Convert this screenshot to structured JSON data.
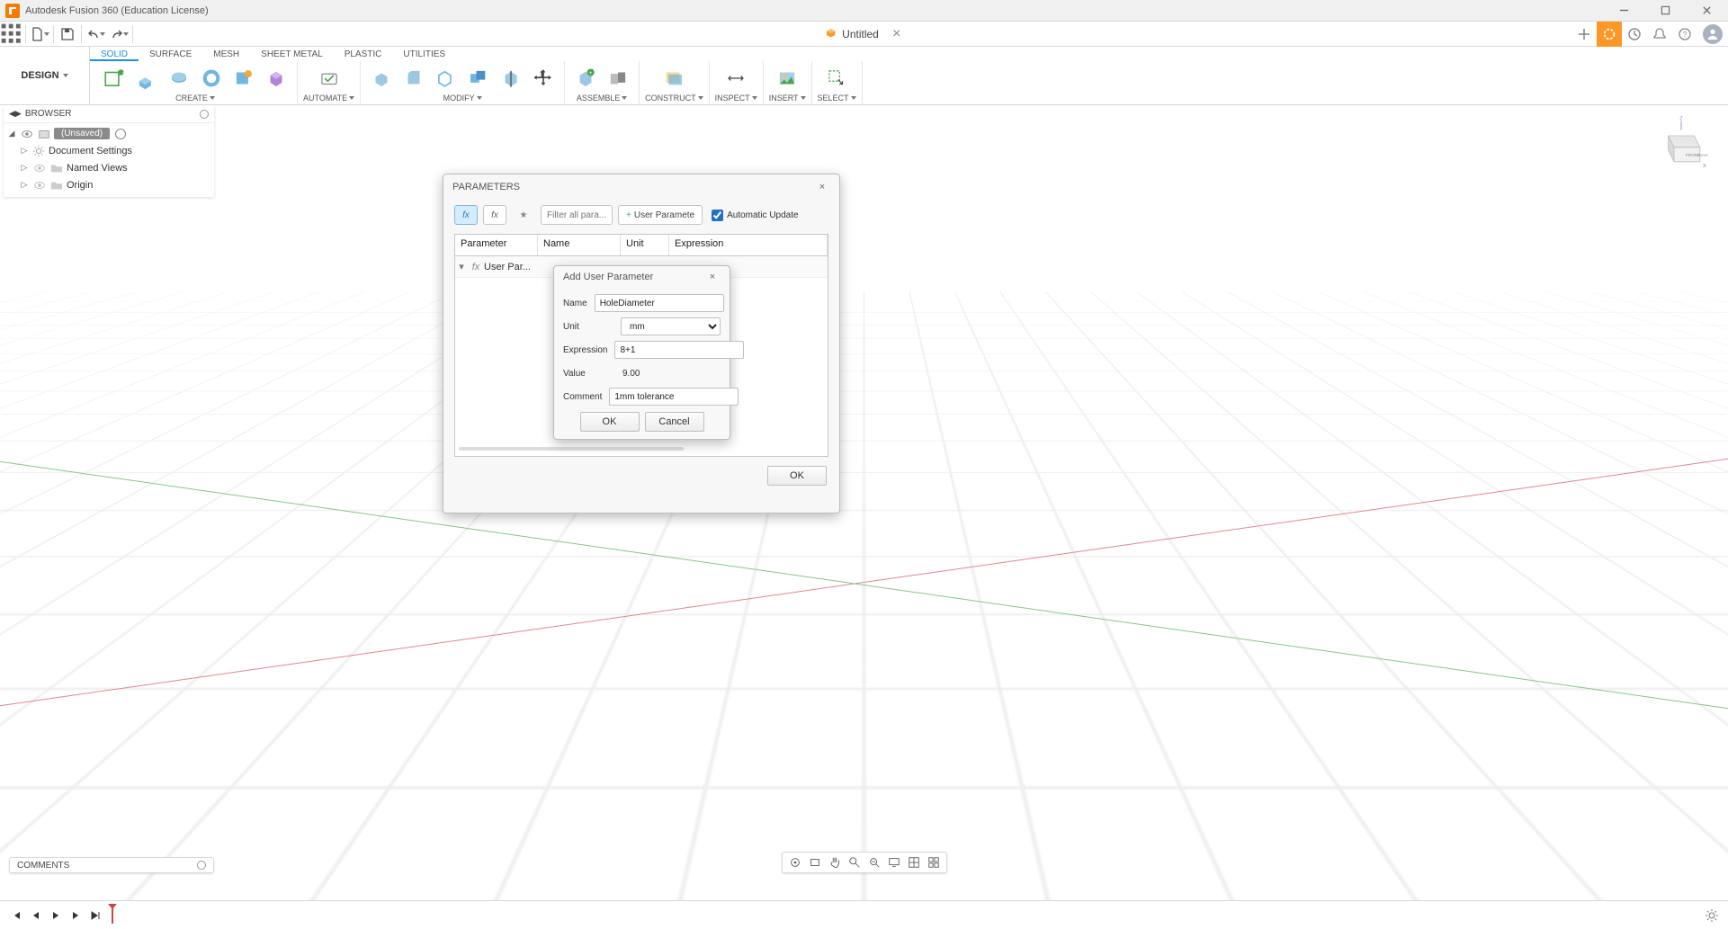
{
  "titlebar": {
    "title": "Autodesk Fusion 360 (Education License)"
  },
  "doctab": {
    "name": "Untitled"
  },
  "workspace": {
    "label": "DESIGN"
  },
  "ribbonTabs": [
    "SOLID",
    "SURFACE",
    "MESH",
    "SHEET METAL",
    "PLASTIC",
    "UTILITIES"
  ],
  "ribbonGroups": {
    "create": "CREATE",
    "automate": "AUTOMATE",
    "modify": "MODIFY",
    "assemble": "ASSEMBLE",
    "construct": "CONSTRUCT",
    "inspect": "INSPECT",
    "insert": "INSERT",
    "select": "SELECT"
  },
  "browser": {
    "title": "BROWSER",
    "root": "(Unsaved)",
    "docSettings": "Document Settings",
    "namedViews": "Named Views",
    "origin": "Origin"
  },
  "commentsBar": {
    "label": "COMMENTS"
  },
  "paramsDialog": {
    "title": "PARAMETERS",
    "filterPlaceholder": "Filter all para...",
    "addBtn": "User Paramete",
    "autoUpdate": "Automatic Update",
    "cols": {
      "param": "Parameter",
      "name": "Name",
      "unit": "Unit",
      "expr": "Expression"
    },
    "rowLabel": "User Par...",
    "okBtn": "OK"
  },
  "userParamDialog": {
    "title": "Add User Parameter",
    "labels": {
      "name": "Name",
      "unit": "Unit",
      "expr": "Expression",
      "value": "Value",
      "comment": "Comment"
    },
    "fields": {
      "name": "HoleDiameter",
      "unit": "mm",
      "expr": "8+1",
      "value": "9.00",
      "comment": "1mm tolerance"
    },
    "ok": "OK",
    "cancel": "Cancel"
  }
}
